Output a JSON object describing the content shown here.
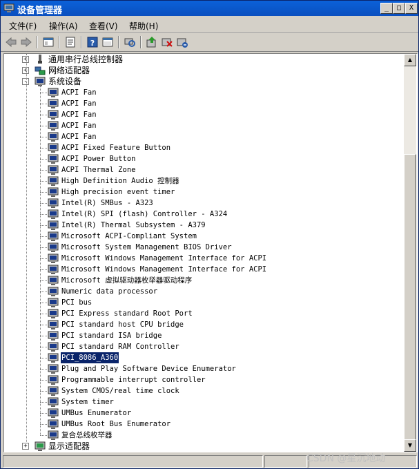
{
  "window": {
    "title": "设备管理器"
  },
  "title_buttons": {
    "minimize": "_",
    "maximize": "□",
    "close": "X"
  },
  "menu": [
    {
      "label": "文件(F)"
    },
    {
      "label": "操作(A)"
    },
    {
      "label": "查看(V)"
    },
    {
      "label": "帮助(H)"
    }
  ],
  "toolbar_icons": [
    "back-icon",
    "forward-icon",
    "tree-view-icon",
    "properties-icon",
    "help-icon",
    "console-icon",
    "scan-hardware-icon",
    "update-driver-icon",
    "uninstall-icon",
    "disable-icon"
  ],
  "tree": {
    "categories_top": [
      {
        "label": "通用串行总线控制器",
        "expand": "+"
      },
      {
        "label": "网络适配器",
        "expand": "+"
      },
      {
        "label": "系统设备",
        "expand": "-"
      }
    ],
    "devices": [
      "ACPI Fan",
      "ACPI Fan",
      "ACPI Fan",
      "ACPI Fan",
      "ACPI Fan",
      "ACPI Fixed Feature Button",
      "ACPI Power Button",
      "ACPI Thermal Zone",
      "High Definition Audio 控制器",
      "High precision event timer",
      "Intel(R) SMBus - A323",
      "Intel(R) SPI (flash) Controller - A324",
      "Intel(R) Thermal Subsystem - A379",
      "Microsoft ACPI-Compliant System",
      "Microsoft System Management BIOS Driver",
      "Microsoft Windows Management Interface for ACPI",
      "Microsoft Windows Management Interface for ACPI",
      "Microsoft 虚拟驱动器枚举器驱动程序",
      "Numeric data processor",
      "PCI bus",
      "PCI Express standard Root Port",
      "PCI standard host CPU bridge",
      "PCI standard ISA bridge",
      "PCI standard RAM Controller",
      "PCI_8086_A360",
      "Plug and Play Software Device Enumerator",
      "Programmable interrupt controller",
      "System CMOS/real time clock",
      "System timer",
      "UMBus Enumerator",
      "UMBus Root Bus Enumerator",
      "复合总线枚举器"
    ],
    "selected": "PCI_8086_A360",
    "category_bottom": {
      "label": "显示适配器",
      "expand": "+"
    }
  },
  "scrollbar": {
    "up": "▲",
    "down": "▼"
  },
  "watermark": "CSDN @星沉地动"
}
